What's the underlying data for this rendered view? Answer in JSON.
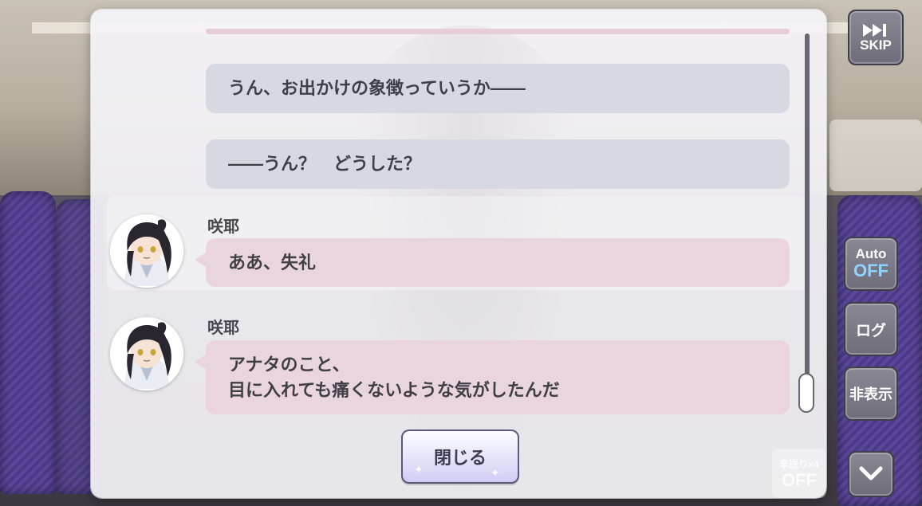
{
  "log": {
    "entries": [
      {
        "type": "narration",
        "text": "うん、お出かけの象徴っていうか――"
      },
      {
        "type": "narration",
        "text": "――うん？　どうした？"
      },
      {
        "type": "speech",
        "speaker": "咲耶",
        "text": "ああ、失礼"
      },
      {
        "type": "speech",
        "speaker": "咲耶",
        "text": "アナタのこと、\n目に入れても痛くないような気がしたんだ"
      }
    ],
    "close_label": "閉じる"
  },
  "controls": {
    "skip_label": "SKIP",
    "auto_label": "Auto",
    "auto_state": "OFF",
    "log_label": "ログ",
    "hide_label": "非表示",
    "speed_label": "早送り×4",
    "speed_state": "OFF"
  },
  "colors": {
    "narration_bubble": "#d6d9e1",
    "speech_bubble": "#ead5de",
    "auto_off_text": "#8fd4ff"
  }
}
